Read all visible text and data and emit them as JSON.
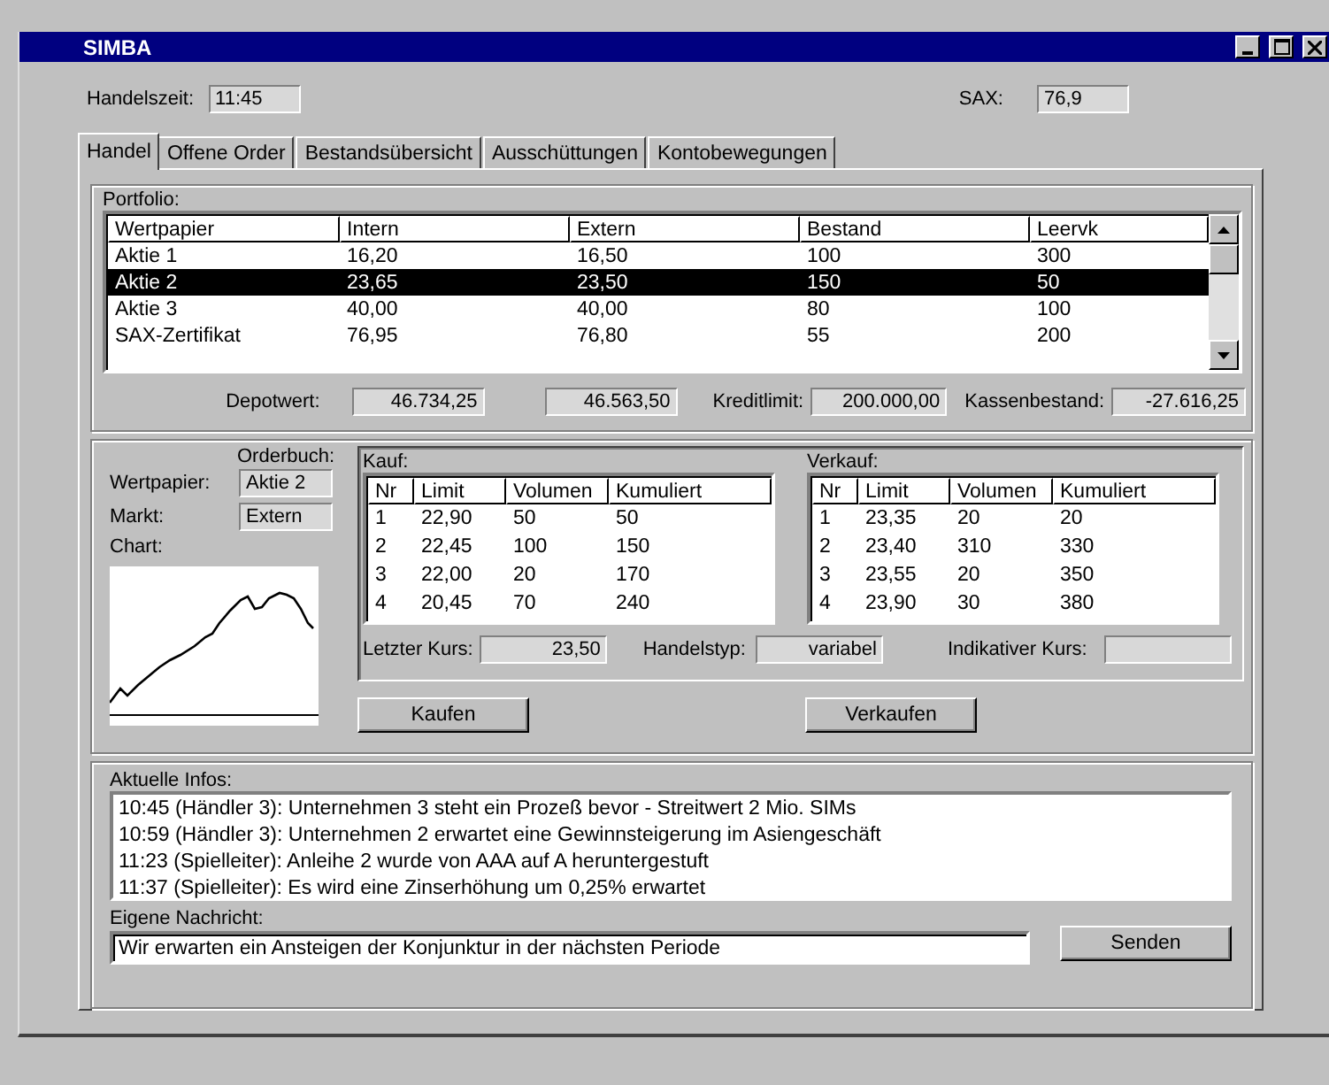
{
  "window": {
    "title": "SIMBA"
  },
  "header": {
    "trading_time": {
      "label": "Handelszeit:",
      "value": "11:45"
    },
    "index": {
      "label": "SAX:",
      "value": "76,9"
    }
  },
  "tabs": [
    {
      "label": "Handel",
      "selected": true
    },
    {
      "label": "Offene Order",
      "selected": false
    },
    {
      "label": "Bestandsübersicht",
      "selected": false
    },
    {
      "label": "Ausschüttungen",
      "selected": false
    },
    {
      "label": "Kontobewegungen",
      "selected": false
    }
  ],
  "portfolio": {
    "title": "Portfolio:",
    "columns": [
      "Wertpapier",
      "Intern",
      "Extern",
      "Bestand",
      "Leervk"
    ],
    "rows": [
      {
        "cells": [
          "Aktie 1",
          "16,20",
          "16,50",
          "100",
          "300"
        ],
        "selected": false
      },
      {
        "cells": [
          "Aktie 2",
          "23,65",
          "23,50",
          "150",
          "50"
        ],
        "selected": true
      },
      {
        "cells": [
          "Aktie 3",
          "40,00",
          "40,00",
          "80",
          "100"
        ],
        "selected": false
      },
      {
        "cells": [
          "SAX-Zertifikat",
          "76,95",
          "76,80",
          "55",
          "200"
        ],
        "selected": false
      }
    ],
    "depot": {
      "label": "Depotwert:",
      "values": [
        "46.734,25",
        "46.563,50"
      ]
    },
    "credit_limit": {
      "label": "Kreditlimit:",
      "value": "200.000,00"
    },
    "cash": {
      "label": "Kassenbestand:",
      "value": "-27.616,25"
    }
  },
  "orderbook": {
    "title": "Orderbuch:",
    "security": {
      "label": "Wertpapier:",
      "value": "Aktie 2"
    },
    "market": {
      "label": "Markt:",
      "value": "Extern"
    },
    "chart_label": "Chart:",
    "buy": {
      "title": "Kauf:",
      "columns": [
        "Nr",
        "Limit",
        "Volumen",
        "Kumuliert"
      ],
      "rows": [
        [
          "1",
          "22,90",
          "50",
          "50"
        ],
        [
          "2",
          "22,45",
          "100",
          "150"
        ],
        [
          "3",
          "22,00",
          "20",
          "170"
        ],
        [
          "4",
          "20,45",
          "70",
          "240"
        ]
      ]
    },
    "sell": {
      "title": "Verkauf:",
      "columns": [
        "Nr",
        "Limit",
        "Volumen",
        "Kumuliert"
      ],
      "rows": [
        [
          "1",
          "23,35",
          "20",
          "20"
        ],
        [
          "2",
          "23,40",
          "310",
          "330"
        ],
        [
          "3",
          "23,55",
          "20",
          "350"
        ],
        [
          "4",
          "23,90",
          "30",
          "380"
        ]
      ]
    },
    "last_price": {
      "label": "Letzter Kurs:",
      "value": "23,50"
    },
    "trade_type": {
      "label": "Handelstyp:",
      "value": "variabel"
    },
    "indicative_price": {
      "label": "Indikativer Kurs:"
    },
    "buttons": [
      "Kaufen",
      "Verkaufen"
    ]
  },
  "infos": {
    "title": "Aktuelle Infos:",
    "lines": [
      "10:45 (Händler 3): Unternehmen 3 steht ein Prozeß bevor - Streitwert 2 Mio. SIMs",
      "10:59 (Händler 3): Unternehmen 2 erwartet eine Gewinnsteigerung im Asiengeschäft",
      "11:23 (Spielleiter): Anleihe 2 wurde von AAA auf A heruntergestuft",
      "11:37 (Spielleiter): Es wird eine Zinserhöhung um 0,25% erwartet"
    ],
    "message": {
      "label": "Eigene Nachricht:",
      "value": "Wir erwarten ein Ansteigen der Konjunktur in der nächsten Periode"
    },
    "send_button": "Senden"
  }
}
